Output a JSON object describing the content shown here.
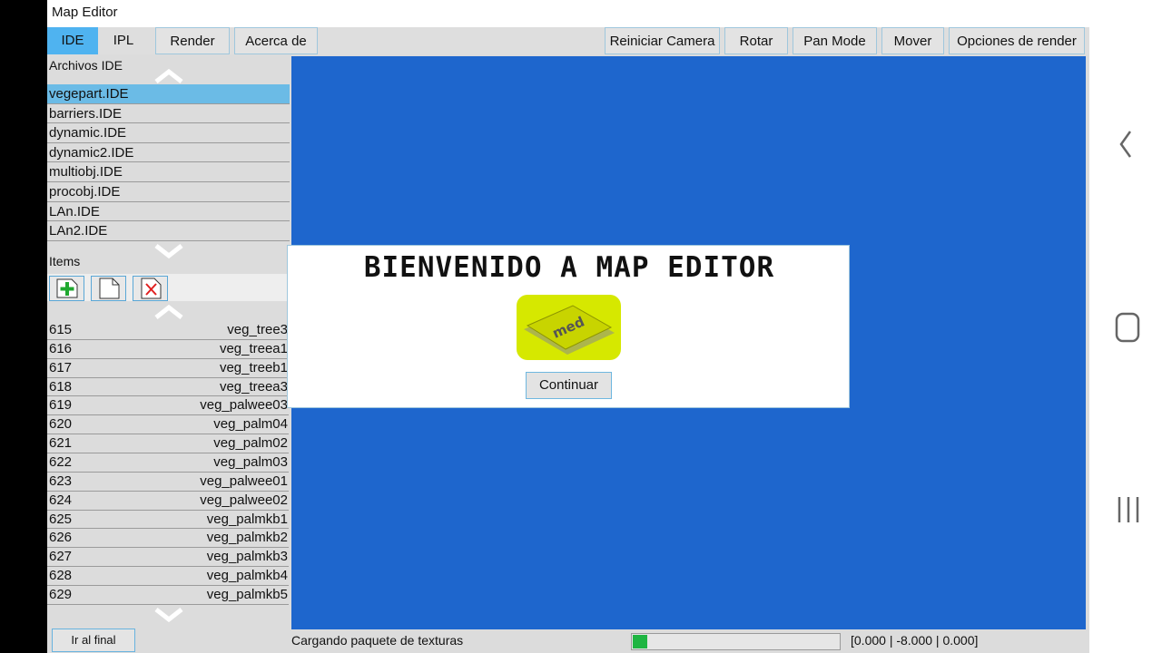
{
  "app": {
    "title": "Map Editor"
  },
  "tabs": [
    {
      "label": "IDE",
      "active": true
    },
    {
      "label": "IPL",
      "active": false
    }
  ],
  "toolbar_left": [
    "Render",
    "Acerca de"
  ],
  "toolbar_right": [
    "Reiniciar Camera",
    "Rotar",
    "Pan Mode",
    "Mover",
    "Opciones de render"
  ],
  "ide_section": {
    "label": "Archivos IDE",
    "selected_index": 0,
    "files": [
      "vegepart.IDE",
      "barriers.IDE",
      "dynamic.IDE",
      "dynamic2.IDE",
      "multiobj.IDE",
      "procobj.IDE",
      "LAn.IDE",
      "LAn2.IDE"
    ]
  },
  "items_section": {
    "label": "Items",
    "buttons": [
      "add-icon",
      "document-icon",
      "delete-icon"
    ],
    "rows": [
      {
        "id": "615",
        "name": "veg_tree3"
      },
      {
        "id": "616",
        "name": "veg_treea1"
      },
      {
        "id": "617",
        "name": "veg_treeb1"
      },
      {
        "id": "618",
        "name": "veg_treea3"
      },
      {
        "id": "619",
        "name": "veg_palwee03"
      },
      {
        "id": "620",
        "name": "veg_palm04"
      },
      {
        "id": "621",
        "name": "veg_palm02"
      },
      {
        "id": "622",
        "name": "veg_palm03"
      },
      {
        "id": "623",
        "name": "veg_palwee01"
      },
      {
        "id": "624",
        "name": "veg_palwee02"
      },
      {
        "id": "625",
        "name": "veg_palmkb1"
      },
      {
        "id": "626",
        "name": "veg_palmkb2"
      },
      {
        "id": "627",
        "name": "veg_palmkb3"
      },
      {
        "id": "628",
        "name": "veg_palmkb4"
      },
      {
        "id": "629",
        "name": "veg_palmkb5"
      }
    ],
    "goto_end_label": "Ir al final"
  },
  "dialog": {
    "title": "BIENVENIDO A MAP EDITOR",
    "logo_text": "med",
    "continue_label": "Continuar"
  },
  "status": {
    "text": "Cargando paquete de texturas",
    "progress": 0.07,
    "coords": "[0.000 | -8.000 | 0.000]"
  },
  "colors": {
    "viewport": "#1e66cd",
    "tab_active": "#4fb3f0",
    "selected_item": "#6bbbe6",
    "progress_fill": "#1fb542",
    "logo_bg": "#d6e800"
  },
  "android_nav": [
    "back-icon",
    "home-icon",
    "recents-icon"
  ]
}
